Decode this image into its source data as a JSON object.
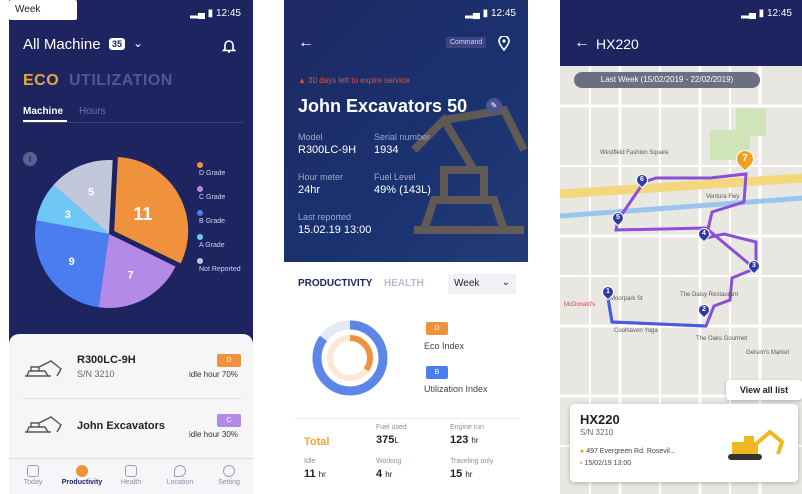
{
  "status_time": "12:45",
  "p1": {
    "title": "All Machine",
    "count": "35",
    "tab_eco": "ECO",
    "tab_util": "UTILIZATION",
    "seg_machine": "Machine",
    "seg_hours": "Hours",
    "period": "Week",
    "info": "i",
    "legend": [
      {
        "label": "D Grade",
        "color": "#f0913c"
      },
      {
        "label": "C Grade",
        "color": "#b48ae8"
      },
      {
        "label": "B Grade",
        "color": "#4a7ef0"
      },
      {
        "label": "A Grade",
        "color": "#6dc8f5"
      },
      {
        "label": "Not Reported",
        "color": "#c3c7da"
      }
    ],
    "machines": [
      {
        "name": "R300LC-9H",
        "sn": "S/N 3210",
        "grade": "D",
        "grade_color": "#f0913c",
        "idle": "idle hour 70%"
      },
      {
        "name": "John Excavators",
        "sn": "",
        "grade": "C",
        "grade_color": "#b48ae8",
        "idle": "idle hour 30%"
      }
    ],
    "nav": [
      "Today",
      "Productivity",
      "Health",
      "Location",
      "Setting"
    ]
  },
  "chart_data": {
    "type": "pie",
    "categories": [
      "D Grade",
      "C Grade",
      "B Grade",
      "A Grade",
      "Not Reported"
    ],
    "values": [
      11,
      7,
      9,
      3,
      5
    ],
    "colors": [
      "#f0913c",
      "#b48ae8",
      "#4a7ef0",
      "#6dc8f5",
      "#c3c7da"
    ]
  },
  "p2": {
    "command": "Command",
    "warning": "30 days left to expire service",
    "name": "John Excavators 50",
    "model_lbl": "Model",
    "model": "R300LC-9H",
    "serial_lbl": "Serial number",
    "serial": "1934",
    "hour_lbl": "Hour meter",
    "hour": "24hr",
    "fuel_lbl": "Fuel Level",
    "fuel": "49% (143L)",
    "reported_lbl": "Last reported",
    "reported": "15.02.19 13:00",
    "tab_prod": "PRODUCTIVITY",
    "tab_health": "HEALTH",
    "period": "Week",
    "eco_grade": "D",
    "eco_label": "Eco Index",
    "util_grade": "B",
    "util_label": "Utilization Index",
    "eco_fill": 0.35,
    "util_fill": 0.85,
    "total": "Total",
    "fuel_used_lbl": "Fuel used",
    "fuel_used": "375",
    "fuel_unit": "L",
    "engine_lbl": "Engine run",
    "engine": "123",
    "engine_unit": "hr",
    "idle_lbl": "Idle",
    "idle": "11",
    "idle_unit": "hr",
    "working_lbl": "Working",
    "working": "4",
    "working_unit": "hr",
    "travel_lbl": "Traveling only",
    "travel": "15",
    "travel_unit": "hr"
  },
  "p3": {
    "title": "HX220",
    "range": "Last Week (15/02/2019 - 22/02/2019)",
    "streets": [
      "Ventura Fwy",
      "Westfield Fashion Square",
      "Moorpark St",
      "McDonald's",
      "Coolhaven Yoga",
      "The Daisy Restaurant",
      "The Oaks Gourmet",
      "Gelson's Market"
    ],
    "stops": [
      "1",
      "2",
      "3",
      "4",
      "5",
      "6",
      "7"
    ],
    "view_all": "View all list",
    "card_title": "HX220",
    "card_sn": "S/N 3210",
    "address": "497 Evergreen Rd. Rosevil...",
    "date": "15/02/19 13:00"
  }
}
